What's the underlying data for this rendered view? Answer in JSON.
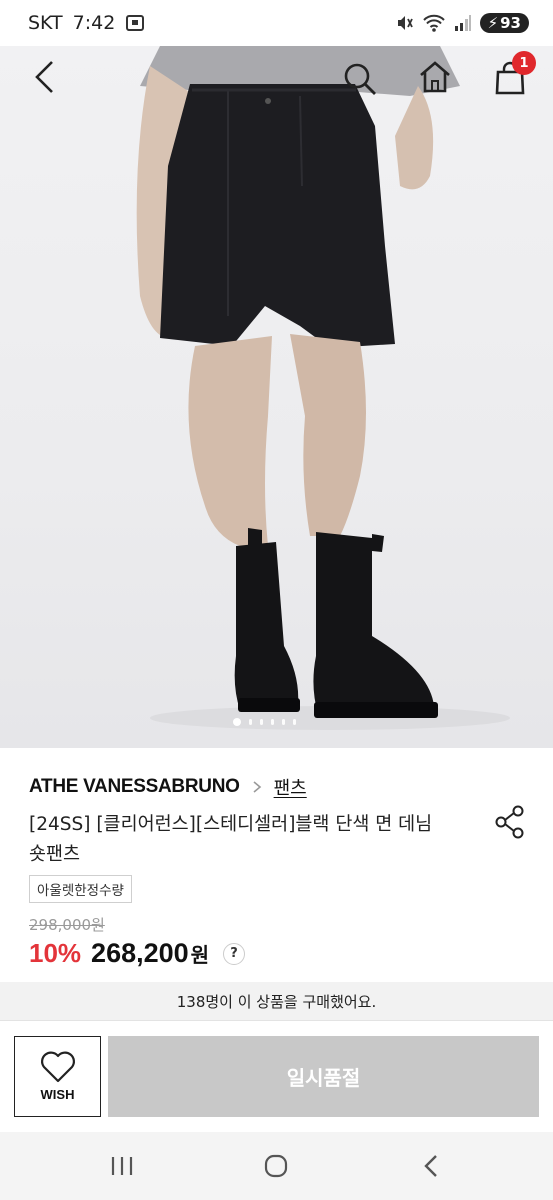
{
  "status_bar": {
    "carrier": "SKT",
    "time": "7:42",
    "battery": "93"
  },
  "header": {
    "back_icon": "chevron-left-icon",
    "search_icon": "search-icon",
    "home_icon": "home-icon",
    "cart_icon": "shopping-bag-icon",
    "cart_count": "1"
  },
  "gallery": {
    "total_images": 6,
    "active_index": 0
  },
  "product": {
    "brand": "ATHE VANESSABRUNO",
    "category": "팬츠",
    "title": "[24SS] [클리어런스][스테디셀러]블랙 단색 면 데님숏팬츠",
    "tag": "아울렛한정수량",
    "original_price": "298,000원",
    "discount": "10%",
    "price": "268,200",
    "currency": "원",
    "help": "?"
  },
  "purchase_banner": "138명이 이 상품을 구매했어요.",
  "actions": {
    "wish_label": "WISH",
    "soldout_label": "일시품절"
  },
  "colors": {
    "discount": "#e3343a",
    "badge": "#e0282c",
    "disabled_button": "#c8c8c8"
  }
}
